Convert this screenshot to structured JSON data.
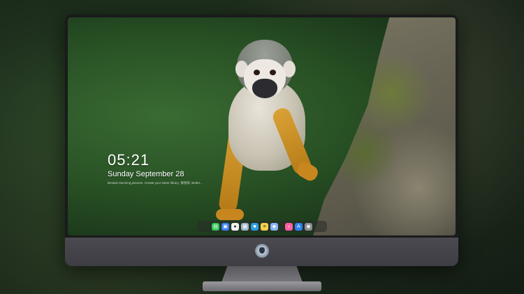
{
  "lock_screen": {
    "time": "05:21",
    "date": "Sunday September  28",
    "hint": "Browse stunning pictures. Create your intent library. 快快快. Better..."
  },
  "dock": {
    "apps": [
      {
        "name": "messages-icon",
        "color": "#34c759",
        "glyph": "▤"
      },
      {
        "name": "finder-icon",
        "color": "#3b82f6",
        "glyph": "▣"
      },
      {
        "name": "clock-icon",
        "color": "#f2f2f2",
        "glyph": "●"
      },
      {
        "name": "preview-icon",
        "color": "#9fb6c8",
        "glyph": "▦"
      },
      {
        "name": "claquette-icon",
        "color": "#2d9cdb",
        "glyph": "■"
      },
      {
        "name": "notes-icon",
        "color": "#f6d04d",
        "glyph": "≡"
      },
      {
        "name": "photos-icon",
        "color": "#8ab4f8",
        "glyph": "◆"
      },
      {
        "name": "music-icon",
        "color": "#ff5fa2",
        "glyph": "♪"
      },
      {
        "name": "app-store-icon",
        "color": "#2f80ed",
        "glyph": "A"
      },
      {
        "name": "camera-icon",
        "color": "#8e8e93",
        "glyph": "◉"
      }
    ]
  }
}
